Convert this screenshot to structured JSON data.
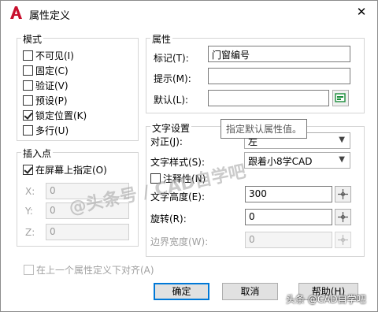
{
  "window": {
    "title": "属性定义",
    "app_icon": "autocad-a-icon",
    "close_glyph": "✕"
  },
  "mode": {
    "group_label": "模式",
    "options": [
      {
        "label": "不可见(I)",
        "checked": false
      },
      {
        "label": "固定(C)",
        "checked": false
      },
      {
        "label": "验证(V)",
        "checked": false
      },
      {
        "label": "预设(P)",
        "checked": false
      },
      {
        "label": "锁定位置(K)",
        "checked": true
      },
      {
        "label": "多行(U)",
        "checked": false
      }
    ]
  },
  "insert_point": {
    "group_label": "插入点",
    "specify_on_screen": {
      "label": "在屏幕上指定(O)",
      "checked": true
    },
    "x_label": "X:",
    "x_value": "0",
    "y_label": "Y:",
    "y_value": "0",
    "z_label": "Z:",
    "z_value": "0"
  },
  "attribute": {
    "group_label": "属性",
    "tag_label": "标记(T):",
    "tag_value": "门窗编号",
    "prompt_label": "提示(M):",
    "prompt_value": "",
    "default_label": "默认(L):",
    "default_value": ""
  },
  "text_settings": {
    "group_label": "文字设置",
    "justify_label": "对正(J):",
    "justify_value": "左",
    "style_label": "文字样式(S):",
    "style_value": "跟着小8学CAD",
    "annotative_label": "注释性(N)",
    "annotative_checked": false,
    "height_label": "文字高度(E):",
    "height_value": "300",
    "rotation_label": "旋转(R):",
    "rotation_value": "0",
    "boundary_label": "边界宽度(W):",
    "boundary_value": "0"
  },
  "tooltip": "指定默认属性值。",
  "align_below": {
    "label": "在上一个属性定义下对齐(A)",
    "checked": false
  },
  "buttons": {
    "ok": "确定",
    "cancel": "取消",
    "help": "帮助(H)"
  },
  "watermarks": {
    "center": "@头条号 / CAD自学吧",
    "footer": "头条 @CAD自学吧"
  },
  "colors": {
    "default_button_border": "#0078d7",
    "icon_red": "#c8102e",
    "field_icon_green": "#1a8c3a"
  }
}
